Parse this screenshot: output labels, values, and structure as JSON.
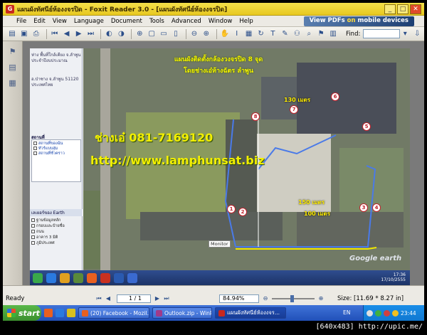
{
  "window": {
    "title": "แผนผังทัศนีย์ห้องงจรปิด - Foxit Reader 3.0 - [แผนผังทัศนีย์ห้องงจรปิด]"
  },
  "menu": [
    "File",
    "Edit",
    "View",
    "Language",
    "Document",
    "Tools",
    "Advanced",
    "Window",
    "Help"
  ],
  "promo": {
    "prefix": "View PDFs ",
    "highlight": "on",
    "suffix": " mobile devices"
  },
  "toolbar": {
    "find_label": "Find:",
    "find_value": ""
  },
  "document": {
    "sidebar": {
      "address1": "ห่าง พื้นที่ใกล้เคียง จ.ลำพูน ประจำปีงบประมาณ",
      "address2": "อ.ป่าซาง จ.ลำพูน 51120 ประเทศไทย",
      "places_head": "สถานที่",
      "places_items": [
        "สถานที่ของฉัน",
        "ทัวร์แบบสุ่ม",
        "สถานที่ชั่วคราว"
      ],
      "layers_head": "เลเยอร์ของ Earth",
      "layers_items": [
        "ฐานข้อมูลหลัก",
        "กรอบและป้ายชื่อ",
        "ถนน",
        "อาคาร 3 มิติ",
        "ภูมิประเทศ"
      ]
    },
    "map": {
      "title_line1": "แผนผังติดตั้งกล้องวงจรปิด 8 จุด",
      "title_line2": "โดยช่างเอ๋ห้างฉัตร ลำพูน",
      "phone": "ช่างเอ๋ 081-7169120",
      "website": "http://www.lamphunsat.biz",
      "distances": [
        "130 เมตร",
        "150 เมตร",
        "100 เมตร"
      ],
      "markers": [
        "1",
        "2",
        "3",
        "4",
        "5",
        "6",
        "7",
        "8"
      ],
      "monitor_label": "Monitor",
      "google_logo": "Google earth",
      "inner_clock_time": "17:36",
      "inner_clock_date": "17/10/2555"
    }
  },
  "status": {
    "ready": "Ready",
    "page": "1 / 1",
    "zoom": "84.94%",
    "size": "Size: [11.69 * 8.27 in]"
  },
  "taskbar": {
    "start": "start",
    "tasks": [
      "(20) Facebook - Mozil...",
      "Outlook.zip - WinRAR",
      "แผนผังทัศนีย์ห้องงจร..."
    ],
    "lang": "EN",
    "clock": "23:44"
  },
  "watermark": "[640x483] http://upic.me/",
  "colors": {
    "titlebar": "#e8c820",
    "map_text": "#f2ef00",
    "cable_blue": "#4a7ae8",
    "cable_yellow": "#f0e800",
    "marker_red": "#c0202a"
  }
}
